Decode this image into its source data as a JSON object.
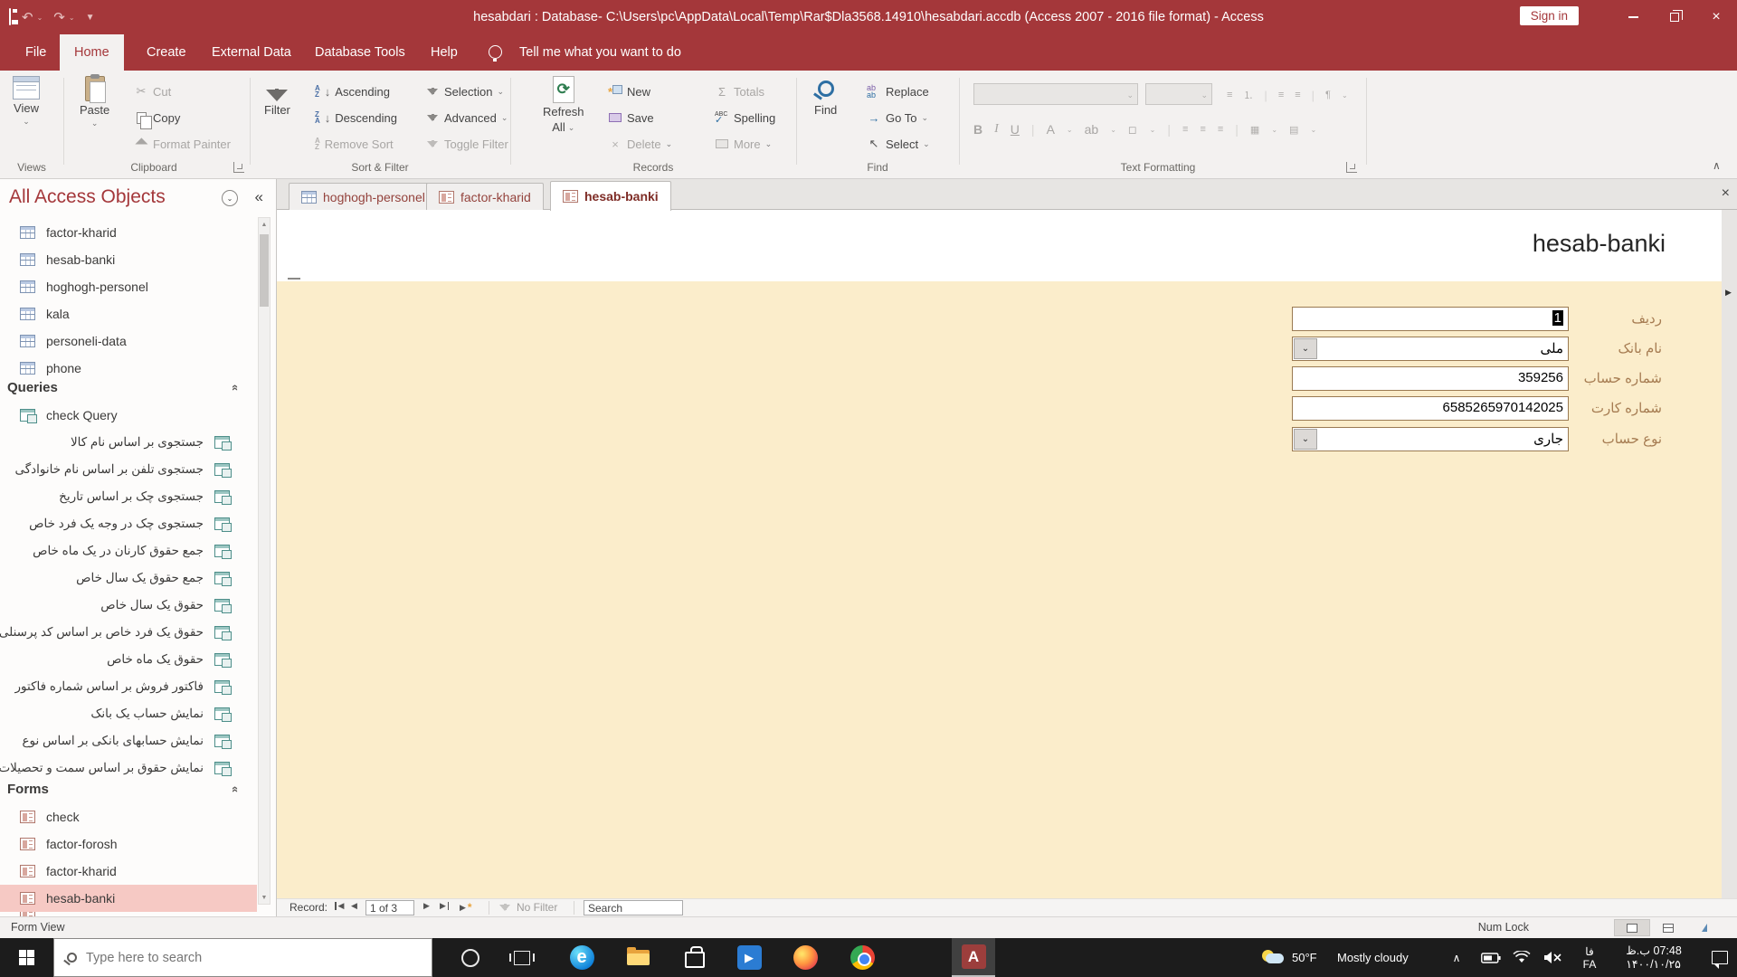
{
  "icons": {
    "caret": "⌄",
    "chevron_up": "∧",
    "shutter": "«",
    "scroll_up": "▲",
    "scroll_down": "▼",
    "prev": "◀",
    "next": "▶",
    "star": "*",
    "sigma": "Σ",
    "check": "✓",
    "abc": "ABC",
    "refresh": "⟳",
    "arrow_right": "→",
    "select_arrow": "↖",
    "scissors": "✂",
    "undo": "↶",
    "redo": "↷",
    "close": "×",
    "dropdown": "▼",
    "az_a": "A",
    "az_z": "Z",
    "arrow_down": "↓",
    "bold": "B",
    "italic": "I",
    "underline": "U",
    "font_a": "A",
    "ab": "ab",
    "pilcrow": "¶",
    "play": "▶",
    "edge_letter": "e",
    "access_letter": "A",
    "bullet_list": "≡",
    "number_list": "⒈",
    "ellipsis_box": "…"
  },
  "titlebar": {
    "title": "hesabdari : Database- C:\\Users\\pc\\AppData\\Local\\Temp\\Rar$Dla3568.14910\\hesabdari.accdb (Access 2007 - 2016 file format)  -  Access",
    "sign_in": "Sign in"
  },
  "menu": {
    "file": "File",
    "home": "Home",
    "create": "Create",
    "external": "External Data",
    "dbtools": "Database Tools",
    "help": "Help",
    "tellme": "Tell me what you want to do"
  },
  "ribbon": {
    "view": "View",
    "views_group": "Views",
    "paste": "Paste",
    "cut": "Cut",
    "copy": "Copy",
    "format_painter": "Format Painter",
    "clipboard_group": "Clipboard",
    "filter": "Filter",
    "ascending": "Ascending",
    "descending": "Descending",
    "remove_sort": "Remove Sort",
    "selection": "Selection",
    "advanced": "Advanced",
    "toggle_filter": "Toggle Filter",
    "sort_group": "Sort & Filter",
    "refresh_1": "Refresh",
    "refresh_2": "All",
    "new": "New",
    "save": "Save",
    "delete": "Delete",
    "totals": "Totals",
    "spelling": "Spelling",
    "more": "More",
    "records_group": "Records",
    "find": "Find",
    "replace": "Replace",
    "goto": "Go To",
    "select": "Select",
    "find_group": "Find",
    "text_group": "Text Formatting"
  },
  "nav": {
    "header": "All Access Objects",
    "tables": [
      "factor-kharid",
      "hesab-banki",
      "hoghogh-personel",
      "kala",
      "personeli-data",
      "phone"
    ],
    "queries_header": "Queries",
    "queries": [
      "check Query",
      "جستجوی بر اساس نام کالا",
      "جستجوی تلفن بر اساس نام خانوادگی",
      "جستجوی چک بر اساس تاریخ",
      "جستجوی چک در وجه یک فرد خاص",
      "جمع حقوق کارنان در یک ماه خاص",
      "جمع حقوق یک سال خاص",
      "حقوق یک سال خاص",
      "حقوق یک فرد خاص بر اساس کد پرسنلی",
      "حقوق یک ماه خاص",
      "فاکتور فروش بر اساس شماره فاکتور",
      "نمایش حساب یک بانک",
      "نمایش حسابهای بانکی بر اساس نوع",
      "نمایش حقوق بر اساس سمت و تحصیلات"
    ],
    "forms_header": "Forms",
    "forms": [
      "check",
      "factor-forosh",
      "factor-kharid",
      "hesab-banki"
    ]
  },
  "doc_tabs": [
    "hoghogh-personel",
    "factor-kharid",
    "hesab-banki"
  ],
  "form": {
    "title": "hesab-banki",
    "fields": [
      {
        "label": "ردیف",
        "value": "1"
      },
      {
        "label": "نام بانک",
        "value": "ملی"
      },
      {
        "label": "شماره حساب",
        "value": "359256"
      },
      {
        "label": "شماره کارت",
        "value": "6585265970142025"
      },
      {
        "label": "نوع حساب",
        "value": "جاری"
      }
    ]
  },
  "record_bar": {
    "label": "Record:",
    "position": "1 of 3",
    "no_filter": "No Filter",
    "search": "Search"
  },
  "status_bar": {
    "view": "Form View",
    "num_lock": "Num Lock"
  },
  "taskbar": {
    "search_placeholder": "Type here to search",
    "weather_temp": "50°F",
    "weather_cond": "Mostly cloudy",
    "lang_fa": "فا",
    "lang_en": "FA",
    "time": "07:48 ب.ظ",
    "date": "۱۴۰۰/۱۰/۲۵"
  },
  "colors": {
    "accent": "#A4373A",
    "form_bg": "#FBEDCB",
    "selection": "#F6C9C4"
  }
}
